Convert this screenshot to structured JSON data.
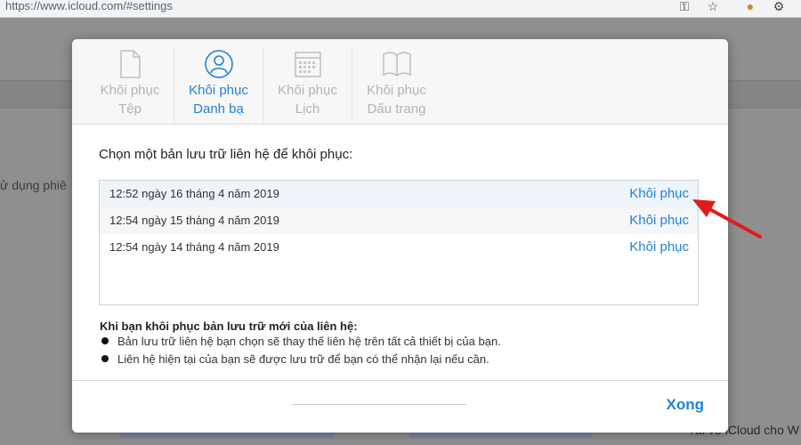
{
  "browser": {
    "url": "https://www.icloud.com/#settings",
    "toolbar_icons": [
      "key-icon",
      "star-icon",
      "cookie-icon",
      "extension-icon"
    ]
  },
  "background": {
    "left_text": "ử dụng phiê",
    "bottom_right_text": "Tải về iCloud cho W"
  },
  "modal": {
    "tabs": [
      {
        "label_line1": "Khôi phục",
        "label_line2": "Tệp",
        "icon": "file-icon",
        "active": false
      },
      {
        "label_line1": "Khôi phục",
        "label_line2": "Danh bạ",
        "icon": "contact-icon",
        "active": true
      },
      {
        "label_line1": "Khôi phục",
        "label_line2": "Lịch",
        "icon": "calendar-icon",
        "active": false
      },
      {
        "label_line1": "Khôi phục",
        "label_line2": "Dấu trang",
        "icon": "bookmark-icon",
        "active": false
      }
    ],
    "prompt": "Chọn một bản lưu trữ liên hệ để khôi phục:",
    "archives": [
      {
        "when": "12:52 ngày 16 tháng 4 năm 2019",
        "action": "Khôi phục"
      },
      {
        "when": "12:54 ngày 15 tháng 4 năm 2019",
        "action": "Khôi phục"
      },
      {
        "when": "12:54 ngày 14 tháng 4 năm 2019",
        "action": "Khôi phục"
      }
    ],
    "info_title": "Khi bạn khôi phục bản lưu trữ mới của liên hệ:",
    "info_items": [
      "Bản lưu trữ liên hệ bạn chọn sẽ thay thế liên hệ trên tất cả thiết bị của bạn.",
      "Liên hệ hiện tại của bạn sẽ được lưu trữ để bạn có thể nhận lại nếu cần."
    ],
    "done_label": "Xong"
  },
  "colors": {
    "accent": "#1f83d6",
    "annotation": "#e01b1b"
  }
}
